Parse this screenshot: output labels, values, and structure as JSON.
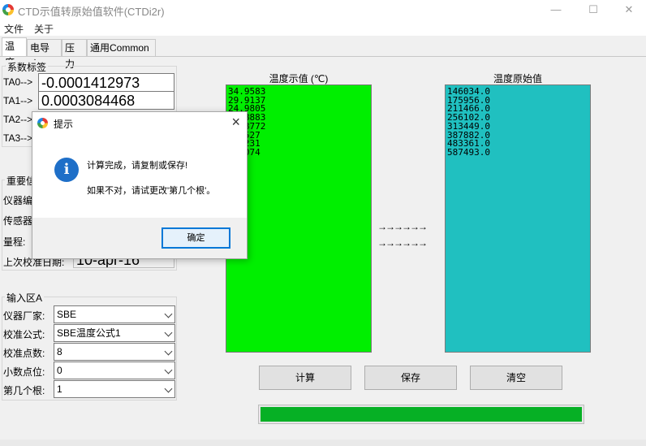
{
  "window": {
    "title": "CTD示值转原始值软件(CTDi2r)",
    "minimize": "—",
    "maximize": "☐",
    "close": "✕"
  },
  "menu": [
    "文件",
    "关于"
  ],
  "tabs": [
    "温度",
    "电导率",
    "压力",
    "通用Common"
  ],
  "coef": {
    "title": "系数标签",
    "rows": [
      {
        "label": "TA0-->",
        "value": "-0.0001412973"
      },
      {
        "label": "TA1-->",
        "value": "0.0003084468"
      },
      {
        "label": "TA2-->",
        "value": ""
      },
      {
        "label": "TA3-->",
        "value": ""
      }
    ]
  },
  "important": {
    "title": "重要信",
    "instrument_label": "仪器编",
    "sensor_label": "传感器",
    "range_label": "量程:",
    "last_cal_label": "上次校准日期:",
    "last_cal_value": "10-apr-16"
  },
  "input_a": {
    "title": "输入区A",
    "fields": [
      {
        "label": "仪器厂家:",
        "value": "SBE"
      },
      {
        "label": "校准公式:",
        "value": "SBE温度公式1"
      },
      {
        "label": "校准点数:",
        "value": "8"
      },
      {
        "label": "小数点位:",
        "value": "0"
      },
      {
        "label": "第几个根:",
        "value": "1"
      }
    ]
  },
  "display_panel": {
    "label": "温度示值 (℃)",
    "color": "#00ef00",
    "values": [
      "34.9583",
      "29.9137",
      "24.9805",
      "19.8883",
      "14.8772",
      "9.0527",
      "4.9231",
      "0.1074"
    ]
  },
  "raw_panel": {
    "label": "温度原始值",
    "color": "#20c0c0",
    "values": [
      "146034.0",
      "175956.0",
      "211466.0",
      "256102.0",
      "313449.0",
      "387882.0",
      "483361.0",
      "587493.0"
    ]
  },
  "arrows": "→→→→→→",
  "buttons": {
    "calc": "计算",
    "save": "保存",
    "clear": "清空"
  },
  "progress": 1.0,
  "dialog": {
    "title": "提示",
    "icon": "i",
    "line1": "计算完成，请复制或保存!",
    "line2": "如果不对，请试更改'第几个根'。",
    "ok": "确定"
  }
}
